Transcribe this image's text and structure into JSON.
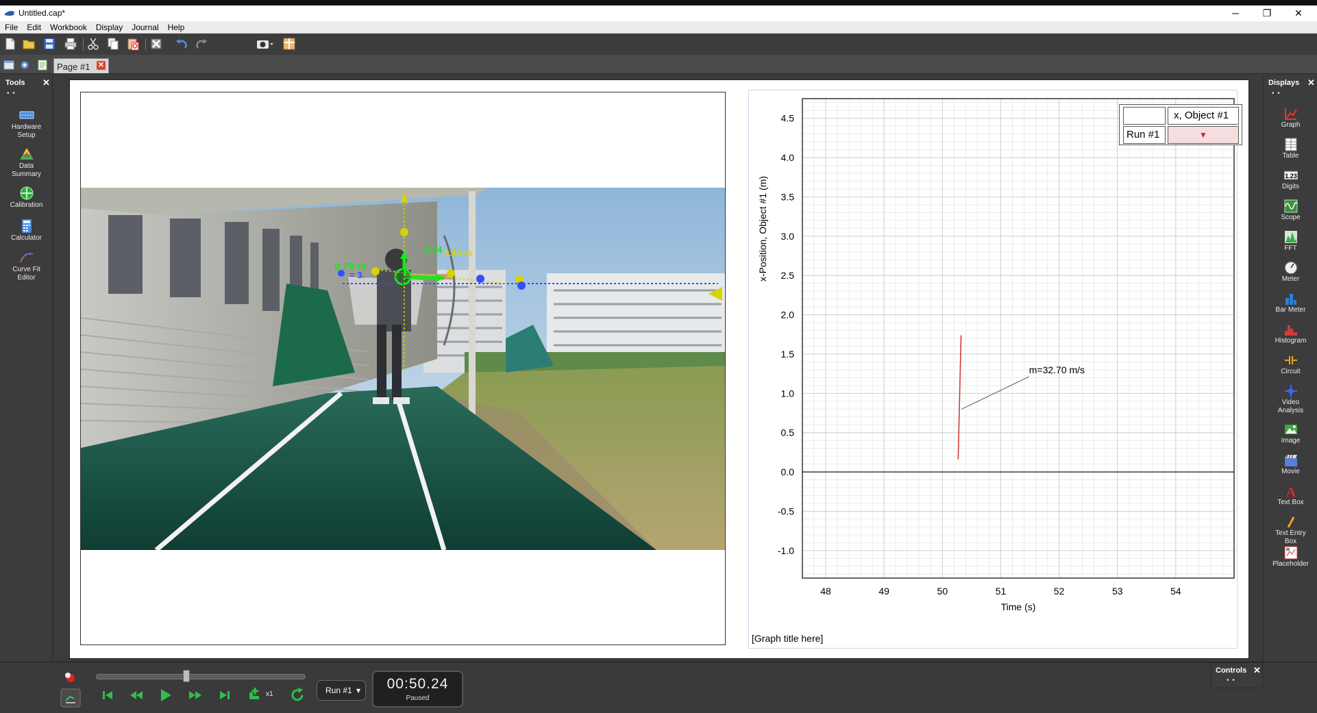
{
  "window": {
    "title": "Untitled.cap*",
    "min": "─",
    "max": "❐",
    "close": "✕"
  },
  "menu": [
    "File",
    "Edit",
    "Workbook",
    "Display",
    "Journal",
    "Help"
  ],
  "tab": {
    "label": "Page #1",
    "close": "✕"
  },
  "tools": {
    "title": "Tools",
    "close": "✕",
    "dots": "• •",
    "items": [
      {
        "label1": "Hardware",
        "label2": "Setup"
      },
      {
        "label1": "Data",
        "label2": "Summary"
      },
      {
        "label1": "Calibration",
        "label2": ""
      },
      {
        "label1": "Calculator",
        "label2": ""
      },
      {
        "label1": "Curve Fit",
        "label2": "Editor"
      }
    ]
  },
  "displays": {
    "title": "Displays",
    "close": "✕",
    "dots": "• •",
    "items": [
      {
        "label1": "Graph",
        "label2": ""
      },
      {
        "label1": "Table",
        "label2": ""
      },
      {
        "label1": "Digits",
        "label2": ""
      },
      {
        "label1": "Scope",
        "label2": ""
      },
      {
        "label1": "FFT",
        "label2": ""
      },
      {
        "label1": "Meter",
        "label2": ""
      },
      {
        "label1": "Bar Meter",
        "label2": ""
      },
      {
        "label1": "Histogram",
        "label2": ""
      },
      {
        "label1": "Circuit",
        "label2": ""
      },
      {
        "label1": "Video",
        "label2": "Analysis"
      },
      {
        "label1": "Image",
        "label2": ""
      },
      {
        "label1": "Movie",
        "label2": ""
      },
      {
        "label1": "Text Box",
        "label2": ""
      },
      {
        "label1": "Text Entry",
        "label2": "Box"
      },
      {
        "label1": "Placeholder",
        "label2": ""
      }
    ]
  },
  "video": {
    "overlay_labels": [
      "0.79 m",
      "0.14",
      "0.86 m",
      "= 3."
    ],
    "colors": {
      "axis_green": "#19e619",
      "track_yellow": "#d4d400",
      "track_blue": "#3050ff"
    }
  },
  "graph": {
    "title": "[Graph title here]",
    "annotation": "m=32.70 m/s",
    "legend": {
      "header_value": "x, Object #1",
      "run": "Run #1",
      "arrow": "▼"
    }
  },
  "chart_data": {
    "type": "line",
    "title": "[Graph title here]",
    "xlabel": "Time (s)",
    "ylabel": "x-Position, Object #1 (m)",
    "xlim": [
      47.6,
      55.0
    ],
    "ylim": [
      -1.35,
      4.75
    ],
    "xticks": [
      48,
      49,
      50,
      51,
      52,
      53,
      54
    ],
    "xtick_labels": [
      "48",
      "49",
      "50",
      "51",
      "52",
      "53",
      "54"
    ],
    "yticks": [
      4.5,
      4.0,
      3.5,
      3.0,
      2.5,
      2.0,
      1.5,
      1.0,
      0.5,
      0.0,
      -0.5,
      -1.0
    ],
    "ytick_labels": [
      "4.5",
      "4.0",
      "3.5",
      "3.0",
      "2.5",
      "2.0",
      "1.5",
      "1.0",
      "0.5",
      "0.0",
      "-0.5",
      "-1.0"
    ],
    "grid": true,
    "series": [
      {
        "name": "Run #1",
        "color": "#d23a3a",
        "x": [
          50.27,
          50.32
        ],
        "y": [
          0.16,
          1.74
        ]
      }
    ],
    "annotations": [
      {
        "text": "m=32.70 m/s",
        "x": 51.25,
        "y": 1.3
      }
    ]
  },
  "controls": {
    "run": "Run #1",
    "run_arrow": "▾",
    "time": "00:50.24",
    "state": "Paused",
    "rate": "x1",
    "panel_title": "Controls",
    "panel_close": "✕",
    "panel_dots": "• •",
    "slider_position": 0.43
  }
}
